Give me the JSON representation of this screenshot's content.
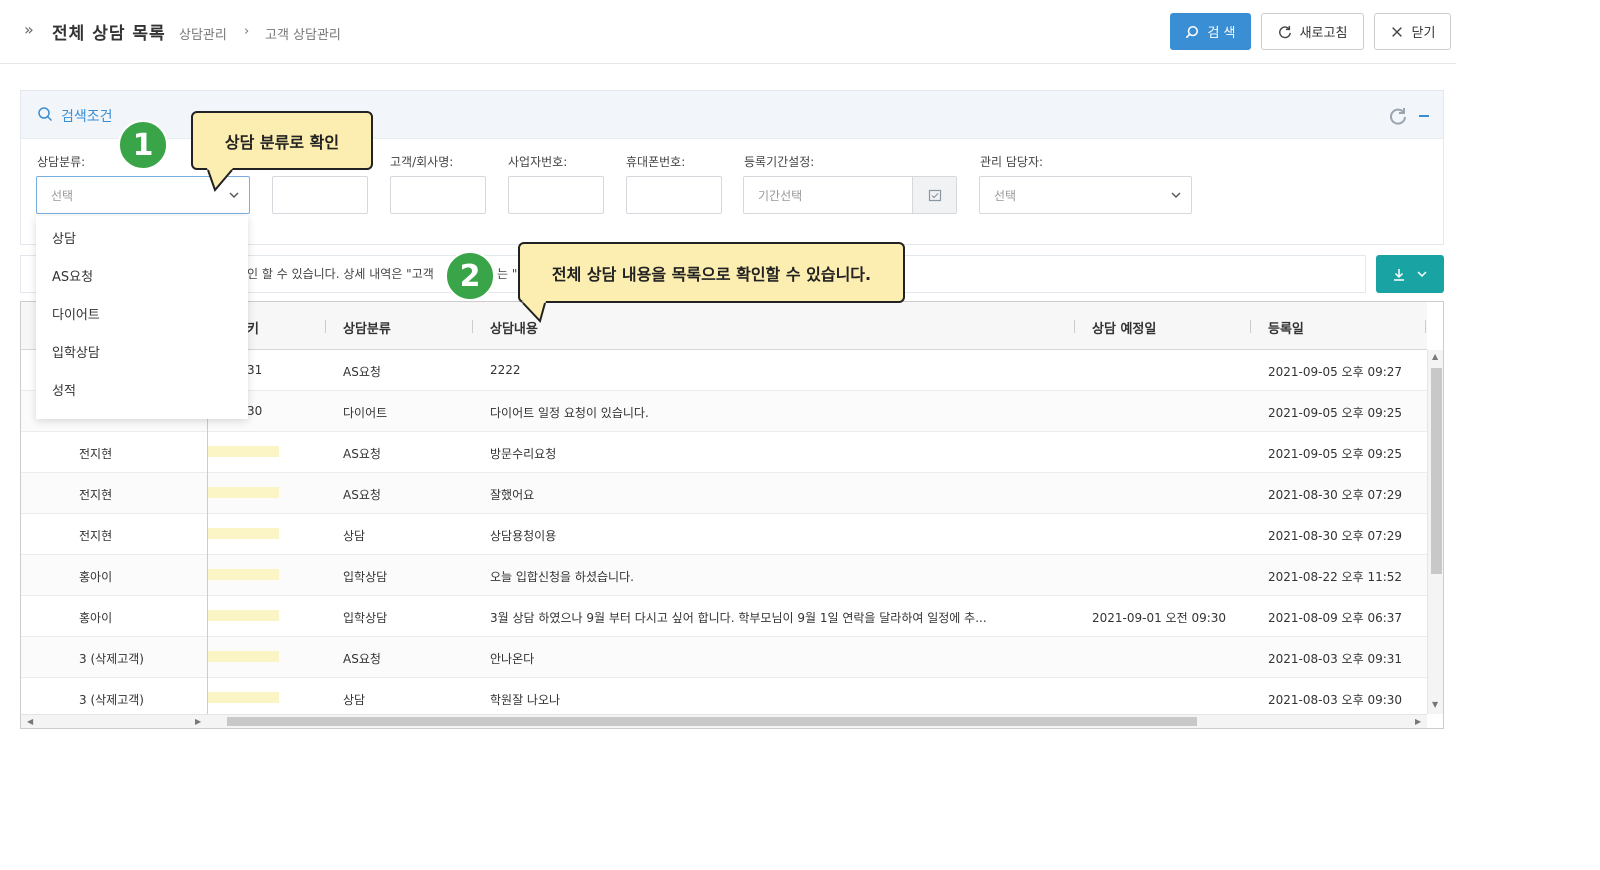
{
  "header": {
    "title": "전체 상담 목록",
    "breadcrumb": [
      "상담관리",
      "고객 상담관리"
    ],
    "buttons": {
      "search": "검 색",
      "refresh": "새로고침",
      "close": "닫기"
    }
  },
  "search_panel": {
    "title": "검색조건",
    "fields": {
      "category_label": "상담분류:",
      "category_value": "선택",
      "customer_label": "고객/회사명:",
      "bizno_label": "사업자번호:",
      "phone_label": "휴대폰번호:",
      "period_label": "등록기간설정:",
      "period_placeholder": "기간선택",
      "manager_label": "관리 담당자:",
      "manager_value": "선택"
    },
    "dropdown_options": [
      "상담",
      "AS요청",
      "다이어트",
      "입학상담",
      "성적"
    ]
  },
  "info_text": "인 할 수 있습니다. 상세 내역은 \"고객",
  "info_text_tail": "는 \"",
  "grid": {
    "columns": [
      "키",
      "상담분류",
      "상담내용",
      "상담 예정일",
      "등록일"
    ],
    "rows": [
      {
        "name": "",
        "key": "31",
        "category": "AS요청",
        "content": "2222",
        "scheduled": "",
        "registered": "2021-09-05 오후 09:27"
      },
      {
        "name": "",
        "key": "30",
        "category": "다이어트",
        "content": "다이어트 일정 요청이 있습니다.",
        "scheduled": "",
        "registered": "2021-09-05 오후 09:25"
      },
      {
        "name": "전지현",
        "key": "",
        "category": "AS요청",
        "content": "방문수리요청",
        "scheduled": "",
        "registered": "2021-09-05 오후 09:25"
      },
      {
        "name": "전지현",
        "key": "",
        "category": "AS요청",
        "content": "잘했어요",
        "scheduled": "",
        "registered": "2021-08-30 오후 07:29"
      },
      {
        "name": "전지현",
        "key": "",
        "category": "상담",
        "content": "상담용청이용",
        "scheduled": "",
        "registered": "2021-08-30 오후 07:29"
      },
      {
        "name": "홍아이",
        "key": "",
        "category": "입학상담",
        "content": "오늘 입합신청을 하셨습니다.",
        "scheduled": "",
        "registered": "2021-08-22 오후 11:52"
      },
      {
        "name": "홍아이",
        "key": "",
        "category": "입학상담",
        "content": "3월 상담 하였으나 9월 부터 다시고 싶어 합니다. 학부모님이 9월 1일 연락을 달라하여 일정에 추...",
        "scheduled": "2021-09-01 오전 09:30",
        "registered": "2021-08-09 오후 06:37"
      },
      {
        "name": "3 (삭제고객)",
        "key": "",
        "category": "AS요청",
        "content": "안나온다",
        "scheduled": "",
        "registered": "2021-08-03 오후 09:31"
      },
      {
        "name": "3 (삭제고객)",
        "key": "",
        "category": "상담",
        "content": "학원잘 나오나",
        "scheduled": "",
        "registered": "2021-08-03 오후 09:30"
      }
    ]
  },
  "callouts": {
    "one": {
      "number": "1",
      "text": "상담 분류로 확인"
    },
    "two": {
      "number": "2",
      "text": "전체 상담 내용을 목록으로 확인할 수 있습니다."
    }
  },
  "colors": {
    "primary": "#3a8ed4",
    "teal": "#1aa3a3",
    "callout": "#fcedb0",
    "badge": "#3aa548"
  }
}
